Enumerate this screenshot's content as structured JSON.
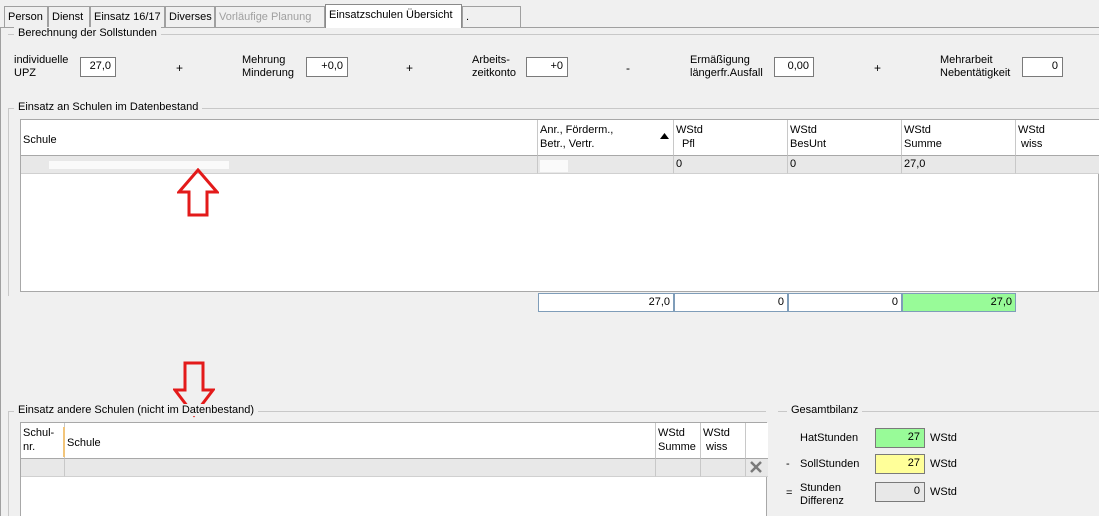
{
  "tabs": [
    {
      "label": "Person",
      "state": "normal"
    },
    {
      "label": "Dienst",
      "state": "normal"
    },
    {
      "label": "Einsatz 16/17",
      "state": "normal"
    },
    {
      "label": "Diverses",
      "state": "normal"
    },
    {
      "label": "Vorläufige Planung",
      "state": "disabled"
    },
    {
      "label": "Einsatzschulen Übersicht",
      "state": "active"
    },
    {
      "label": ".",
      "state": "normal"
    }
  ],
  "soll": {
    "title": "Berechnung der Sollstunden",
    "upz_label1": "individuelle",
    "upz_label2": "UPZ",
    "upz_value": "27,0",
    "op1": "+",
    "mehr_label1": "Mehrung",
    "mehr_label2": "Minderung",
    "mehr_value": "+0,0",
    "op2": "+",
    "arb_label1": "Arbeits-",
    "arb_label2": "zeitkonto",
    "arb_value": "+0",
    "op3": "-",
    "erm_label1": "Ermäßigung",
    "erm_label2": "längerfr.Ausfall",
    "erm_value": "0,00",
    "op4": "+",
    "mehrarb_label1": "Mehrarbeit",
    "mehrarb_label2": "Nebentätigkeit",
    "mehrarb_value": "0"
  },
  "einsatz": {
    "title": "Einsatz an Schulen im Datenbestand",
    "headers": {
      "schule": "Schule",
      "anr1": "Anr., Förderm.,",
      "anr2": "Betr., Vertr.",
      "pfl1": "WStd",
      "pfl2": "Pfl",
      "besunt1": "WStd",
      "besunt2": "BesUnt",
      "summe1": "WStd",
      "summe2": "Summe",
      "wiss1": "WStd",
      "wiss2": "wiss"
    },
    "row": {
      "pfl": "0",
      "besunt": "0",
      "summe": "27,0"
    },
    "totals": {
      "anr": "27,0",
      "pfl": "0",
      "besunt": "0",
      "summe": "27,0"
    }
  },
  "andere": {
    "title": "Einsatz andere Schulen (nicht im Datenbestand)",
    "headers": {
      "nr1": "Schul-",
      "nr2": "nr.",
      "schule": "Schule",
      "summe1": "WStd",
      "summe2": "Summe",
      "wiss1": "WStd",
      "wiss2": "wiss"
    }
  },
  "bilanz": {
    "title": "Gesamtbilanz",
    "hat_label": "HatStunden",
    "hat_value": "27",
    "hat_unit": "WStd",
    "soll_prefix": "-",
    "soll_label": "SollStunden",
    "soll_value": "27",
    "soll_unit": "WStd",
    "diff_prefix": "=",
    "diff_label1": "Stunden",
    "diff_label2": "Differenz",
    "diff_value": "0",
    "diff_unit": "WStd"
  },
  "colors": {
    "green": "#98fb98",
    "yellow": "#ffff99",
    "arrow": "#e31a1a"
  }
}
